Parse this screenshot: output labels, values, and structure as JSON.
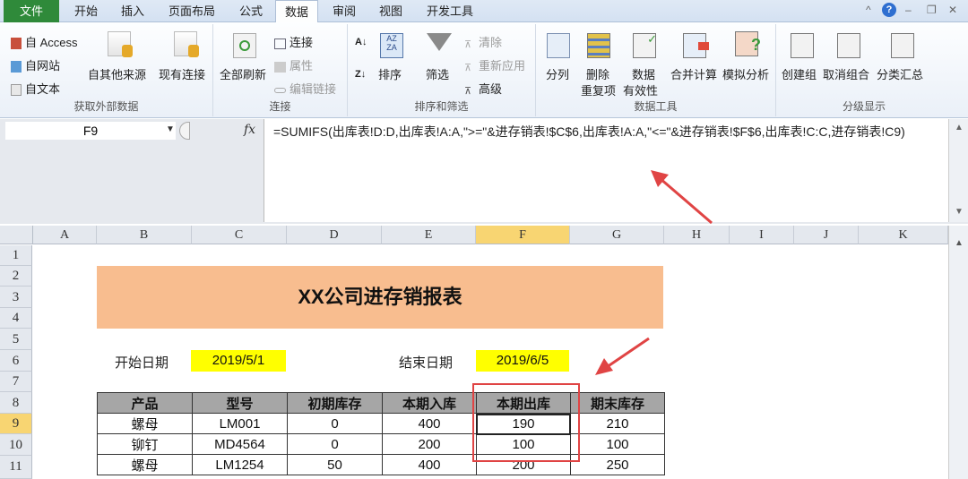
{
  "tabs": [
    {
      "label": "文件"
    },
    {
      "label": "开始"
    },
    {
      "label": "插入"
    },
    {
      "label": "页面布局"
    },
    {
      "label": "公式"
    },
    {
      "label": "数据"
    },
    {
      "label": "审阅"
    },
    {
      "label": "视图"
    },
    {
      "label": "开发工具"
    }
  ],
  "active_tab": "数据",
  "window_controls": {
    "minimize_ribbon": "^",
    "help": "?",
    "minimize": "–",
    "restore": "❐",
    "close": "✕"
  },
  "ribbon": {
    "groups": [
      {
        "label": "获取外部数据",
        "items": [
          "自 Access",
          "自网站",
          "自文本",
          "自其他来源",
          "现有连接"
        ]
      },
      {
        "label": "连接",
        "items": [
          "全部刷新",
          "连接",
          "属性",
          "编辑链接"
        ]
      },
      {
        "label": "排序和筛选",
        "items": [
          "排序",
          "筛选",
          "清除",
          "重新应用",
          "高级"
        ]
      },
      {
        "label": "数据工具",
        "items": [
          "分列",
          "删除",
          "重复项",
          "数据",
          "有效性",
          "合并计算",
          "模拟分析"
        ]
      },
      {
        "label": "分级显示",
        "items": [
          "创建组",
          "取消组合",
          "分类汇总"
        ]
      }
    ]
  },
  "formula_bar": {
    "name_box": "F9",
    "fx": "fx",
    "formula": "=SUMIFS(出库表!D:D,出库表!A:A,\">=\"&进存销表!$C$6,出库表!A:A,\"<=\"&进存销表!$F$6,出库表!C:C,进存销表!C9)"
  },
  "columns": [
    "A",
    "B",
    "C",
    "D",
    "E",
    "F",
    "G",
    "H",
    "I",
    "J",
    "K"
  ],
  "selected_column": "F",
  "rows": [
    "1",
    "2",
    "3",
    "4",
    "5",
    "6",
    "7",
    "8",
    "9",
    "10",
    "11"
  ],
  "selected_row": "9",
  "sheet": {
    "title": "XX公司进存销报表",
    "start_label": "开始日期",
    "start_date": "2019/5/1",
    "end_label": "结束日期",
    "end_date": "2019/6/5",
    "headers": [
      "产品",
      "型号",
      "初期库存",
      "本期入库",
      "本期出库",
      "期末库存"
    ],
    "data": [
      [
        "螺母",
        "LM001",
        "0",
        "400",
        "190",
        "210"
      ],
      [
        "铆钉",
        "MD4564",
        "0",
        "200",
        "100",
        "100"
      ],
      [
        "螺母",
        "LM1254",
        "50",
        "400",
        "200",
        "250"
      ]
    ]
  },
  "annotation_color": "#e04444"
}
